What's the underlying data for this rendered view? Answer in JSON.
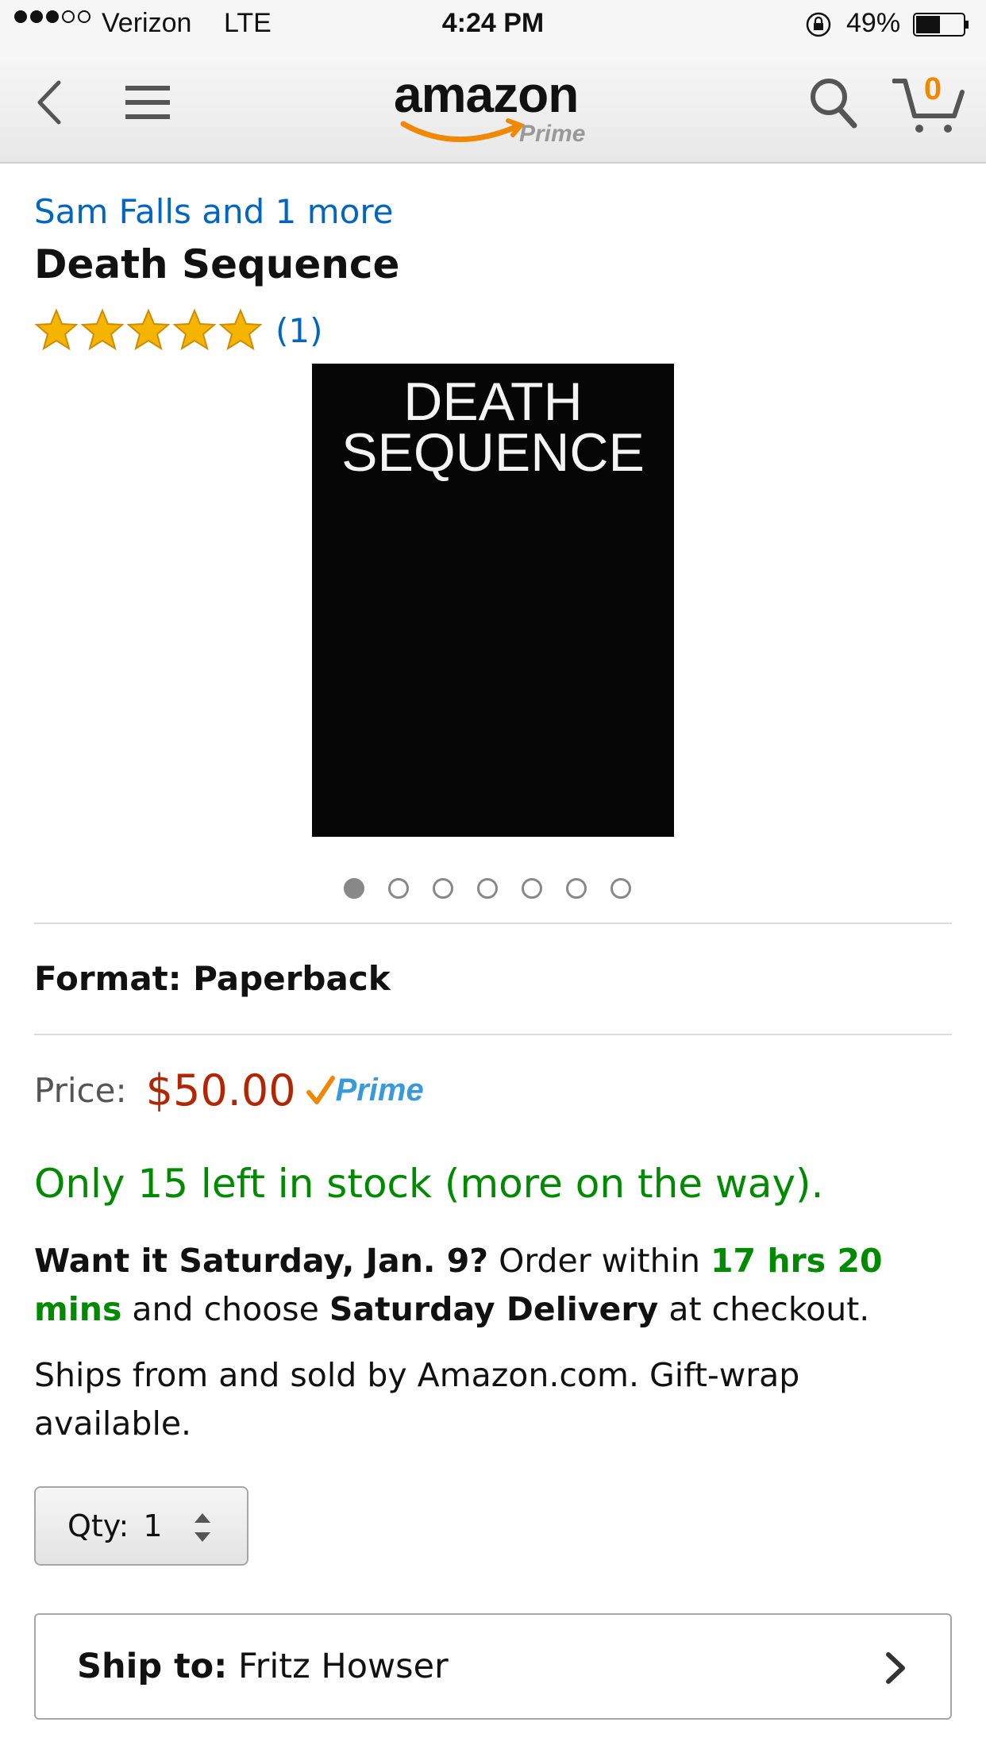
{
  "status_bar": {
    "carrier": "Verizon",
    "network": "LTE",
    "time": "4:24 PM",
    "battery": "49%",
    "signal_bars": 3,
    "signal_total": 5
  },
  "nav": {
    "logo_text": "amazon",
    "logo_sub": "Prime",
    "cart_count": "0",
    "icons": [
      "back-icon",
      "menu-icon",
      "search-icon",
      "cart-icon"
    ]
  },
  "product": {
    "author": "Sam Falls and 1 more",
    "title": "Death Sequence",
    "rating_stars": 5,
    "review_count": "(1)",
    "cover_text_line1": "DEATH",
    "cover_text_line2": "SEQUENCE",
    "image_count": 7,
    "image_active_index": 0,
    "format": "Format: Paperback",
    "price_label": "Price:",
    "price_value": "$50.00",
    "prime_badge": "Prime",
    "stock": "Only 15 left in stock (more on the way).",
    "delivery": {
      "want_it": "Want it Saturday, Jan. 9?",
      "order_within": " Order within ",
      "countdown": "17 hrs 20 mins",
      "and_choose": " and choose ",
      "saturday_delivery": "Saturday Delivery",
      "at_checkout": " at checkout."
    },
    "ships_info": "Ships from and sold by Amazon.com. Gift-wrap available.",
    "qty_label": "Qty:",
    "qty_value": "1",
    "ship_to_label": "Ship to:",
    "ship_to_name": "Fritz Howser"
  },
  "colors": {
    "link": "#0066c0",
    "price": "#b12704",
    "stock": "#008a00",
    "accent": "#f08804",
    "prime": "#3a9ad9"
  }
}
